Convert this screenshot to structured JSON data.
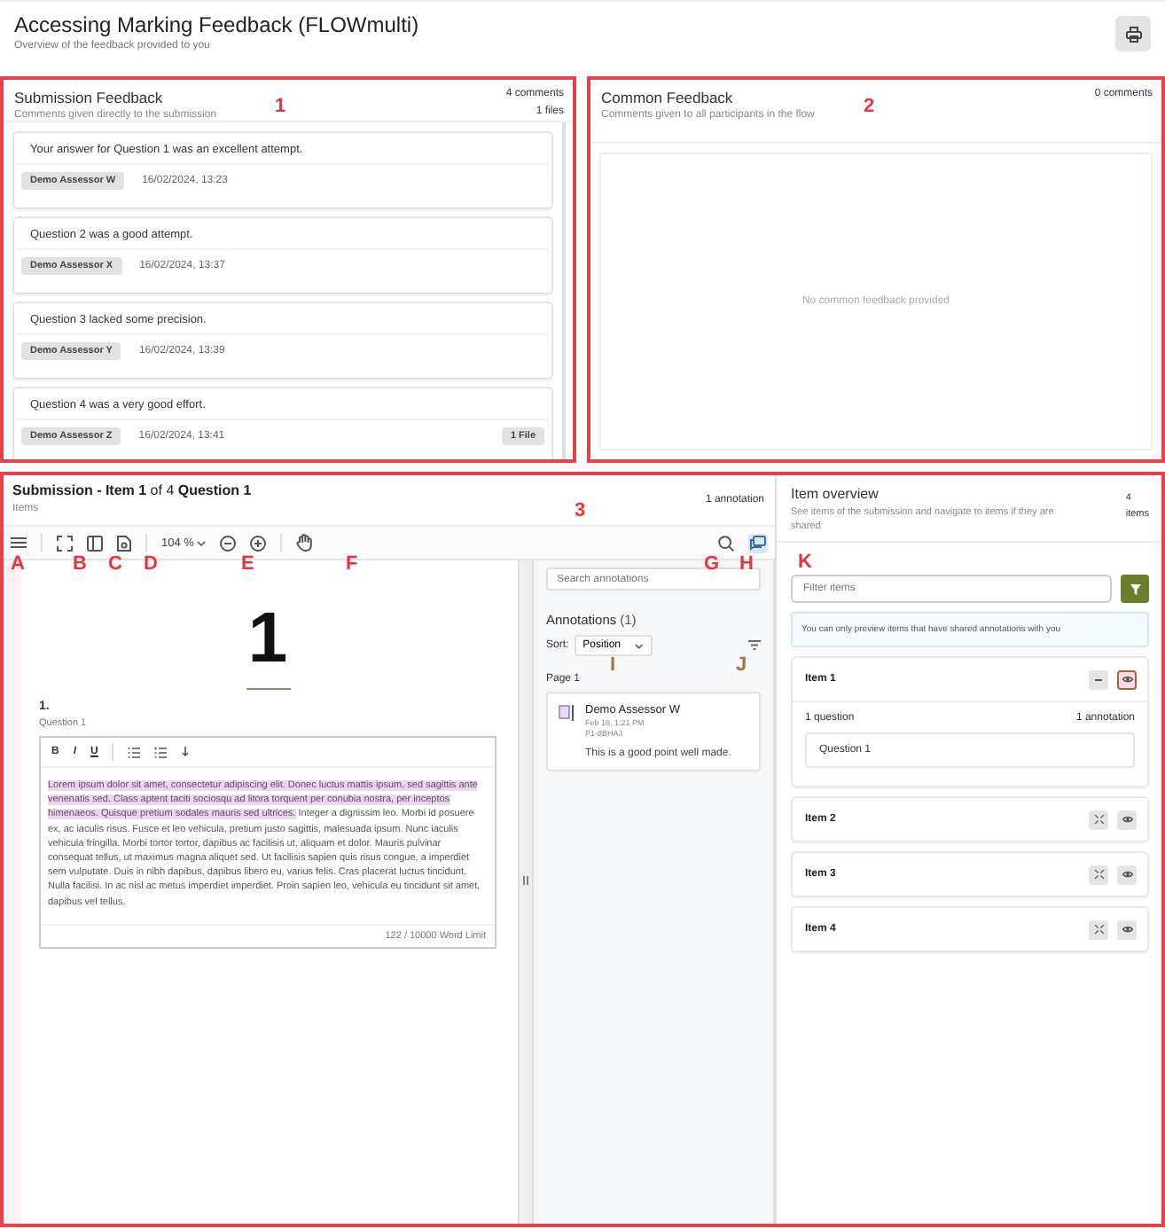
{
  "header": {
    "title": "Accessing Marking Feedback (FLOWmulti)",
    "subtitle": "Overview of the feedback provided to you"
  },
  "submission_feedback": {
    "title": "Submission Feedback",
    "subtitle": "Comments given directly to the submission",
    "comment_count": "4 comments",
    "file_count": "1 files",
    "comments": [
      {
        "text": "Your answer for Question 1 was an excellent attempt.",
        "assessor": "Demo Assessor W",
        "date": "16/02/2024, 13:23"
      },
      {
        "text": "Question 2 was a good attempt.",
        "assessor": "Demo Assessor X",
        "date": "16/02/2024, 13:37"
      },
      {
        "text": "Question 3 lacked some precision.",
        "assessor": "Demo Assessor Y",
        "date": "16/02/2024, 13:39"
      },
      {
        "text": "Question 4 was a very good effort.",
        "assessor": "Demo Assessor Z",
        "date": "16/02/2024, 13:41",
        "files": "1 File"
      }
    ]
  },
  "common_feedback": {
    "title": "Common Feedback",
    "subtitle": "Comments given to all participants in the flow",
    "comment_count": "0 comments",
    "empty_text": "No common feedback provided"
  },
  "submission": {
    "title": "**Submission - Item 1** of 4 **Question 1**",
    "subtitle": "Items",
    "annotation_count": "1 annotation",
    "toolbar": {
      "zoom": "104 %",
      "annotations_panel_open": true
    },
    "document": {
      "page_number": "1",
      "question_number": "1.",
      "question_label": "Question 1",
      "editor_tools": [
        "B",
        "I",
        "U"
      ],
      "highlighted_text": "Lorem ipsum dolor sit amet, consectetur adipiscing elit. Donec luctus mattis ipsum, sed sagittis ante venenatis sed. Class aptent taciti sociosqu ad litora torquent per conubia nostra, per inceptos himenaeos. Quisque pretium sodales mauris sed ultrices.",
      "text": "Integer a dignissim leo. Morbi id posuere ex, ac iaculis risus. Fusce et leo vehicula, pretium justo sagittis, malesuada ipsum. Nunc iaculis vehicula fringilla. Morbi tortor tortor, dapibus ac facilisis ut, aliquam et dolor. Mauris pulvinar consequat tellus, ut maximus magna aliquet sed. Ut facilisis sapien quis risus congue, a imperdiet sem vulputate. Duis in nibh dapibus, dapibus libero eu, varius felis. Cras placerat luctus tincidunt. Nulla facilisi. In ac nisl ac metus imperdiet imperdiet. Proin sapien leo, vehicula eu tincidunt sit amet, dapibus vel tellus.",
      "word_count": "122 / 10000 Word Limit"
    },
    "annotations": {
      "search_placeholder": "Search annotations",
      "title": "Annotations",
      "count": "(1)",
      "sort_label": "Sort:",
      "sort_value": "Position",
      "page_label": "Page 1",
      "items": [
        {
          "author": "Demo Assessor W",
          "time": "Feb 16, 1:21 PM",
          "ref": "P1-8BHAJ",
          "text": "This is a good point well made."
        }
      ]
    }
  },
  "item_overview": {
    "title": "Item overview",
    "subtitle": "See items of the submission and navigate to items if they are shared",
    "count": "4",
    "count_label": "items",
    "filter_placeholder": "Filter items",
    "notice": "You can only preview items that have shared annotations with you",
    "items": [
      {
        "name": "Item 1",
        "expanded": true,
        "selected": true,
        "questions": "1 question",
        "annotations": "1 annotation",
        "question_items": [
          "Question 1"
        ]
      },
      {
        "name": "Item 2",
        "expanded": false,
        "selected": false
      },
      {
        "name": "Item 3",
        "expanded": false,
        "selected": false
      },
      {
        "name": "Item 4",
        "expanded": false,
        "selected": false
      }
    ]
  },
  "callouts": [
    {
      "label": "1",
      "color": "#e8333f"
    },
    {
      "label": "2",
      "color": "#e8333f"
    },
    {
      "label": "3",
      "color": "#e8333f"
    },
    {
      "label": "A",
      "color": "#e8333f"
    },
    {
      "label": "B",
      "color": "#e8333f"
    },
    {
      "label": "C",
      "color": "#e8333f"
    },
    {
      "label": "D",
      "color": "#e8333f"
    },
    {
      "label": "E",
      "color": "#e8333f"
    },
    {
      "label": "F",
      "color": "#e8333f"
    },
    {
      "label": "G",
      "color": "#e8333f"
    },
    {
      "label": "H",
      "color": "#e8333f"
    },
    {
      "label": "I",
      "color": "#9a7a3a"
    },
    {
      "label": "J",
      "color": "#9a7a3a"
    },
    {
      "label": "K",
      "color": "#e8333f"
    }
  ]
}
